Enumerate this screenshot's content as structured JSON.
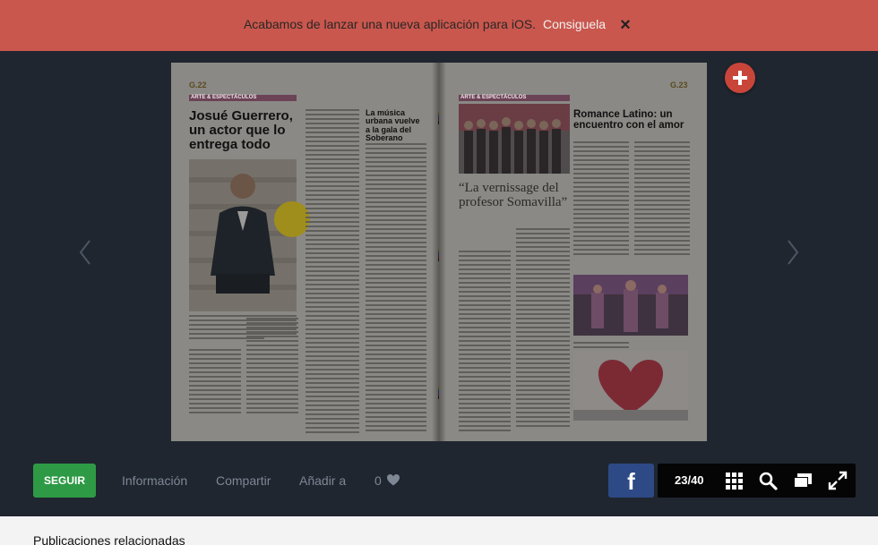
{
  "banner": {
    "message": "Acabamos de lanzar una nueva aplicación para iOS.",
    "link": "Consiguela",
    "close": "×"
  },
  "magazine": {
    "left_page": {
      "page_number": "G.22",
      "section": "ARTE & ESPECTÁCULOS",
      "headline": "Josué Guerrero, un actor que lo entrega todo",
      "sub_headline": "La música urbana vuelve a la gala del Soberano"
    },
    "right_page": {
      "page_number": "G.23",
      "section": "ARTE & ESPECTÁCULOS",
      "headline": "Romance Latino: un encuentro con el amor",
      "feature": "“La vernissage del profesor Somavilla”"
    }
  },
  "toolbar": {
    "follow": "SEGUIR",
    "info": "Información",
    "share": "Compartir",
    "add_to": "Añadir a",
    "likes": "0",
    "facebook": "f",
    "page_count": "23/40"
  },
  "icons": {
    "prev": "chevron-left-icon",
    "next": "chevron-right-icon",
    "add": "plus-icon",
    "grid": "grid-icon",
    "search": "search-icon",
    "pages": "pages-icon",
    "fullscreen": "fullscreen-icon",
    "heart": "heart-icon"
  },
  "colors": {
    "banner": "#c9574d",
    "follow": "#2f9a45",
    "facebook": "#2d4a86",
    "fab": "#c9453a"
  },
  "related": {
    "title": "Publicaciones relacionadas"
  }
}
